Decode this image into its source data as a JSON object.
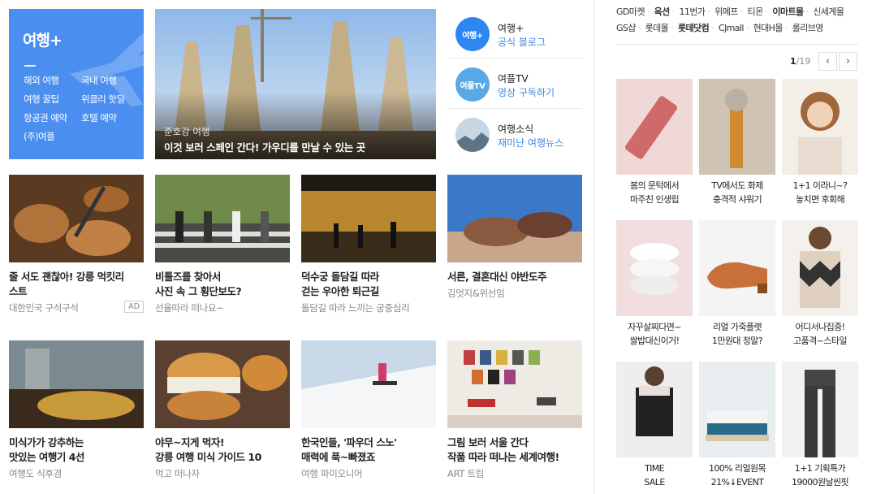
{
  "promo": {
    "title": "여행+",
    "links": [
      "해외 여행",
      "국내 여행",
      "여행 꿀팁",
      "위클리 핫딜",
      "항공권 예약",
      "호텔 예약",
      "(주)여플"
    ]
  },
  "hero": {
    "subtitle": "준호강 여행",
    "title": "이것 보러 스페인 간다! 가우디를 만날 수 있는 곳"
  },
  "channels": [
    {
      "logo": "여행+",
      "name": "여행+",
      "desc": "공식 블로그",
      "color": "#2f86f2"
    },
    {
      "logo": "여플TV",
      "name": "여플TV",
      "desc": "영상 구독하기",
      "color": "#5aa9e6"
    },
    {
      "logo": "",
      "name": "여행소식",
      "desc": "재미난 여행뉴스",
      "color": "#9fb6c8"
    }
  ],
  "cards": [
    {
      "line1": "줄 서도 괜찮아! 강릉 먹킷리",
      "line2": "스트",
      "source": "대한민국 구석구석",
      "badge": "AD"
    },
    {
      "line1": "비틀즈를 찾아서",
      "line2": "사진 속 그 횡단보도?",
      "source": "선율따라 떠나요~"
    },
    {
      "line1": "덕수궁 돌담길 따라",
      "line2": "걷는 우아한 퇴근길",
      "source": "돌담길 따라 느끼는 궁중심리"
    },
    {
      "line1": "서른, 결혼대신 야반도주",
      "line2": "",
      "source": "김멋지&위선임"
    },
    {
      "line1": "미식가가 강추하는",
      "line2": "맛있는 여행기 4선",
      "source": "여행도 식후경"
    },
    {
      "line1": "야무~지게 먹자!",
      "line2": "강릉 여행 미식 가이드 10",
      "source": "먹고 떠나자"
    },
    {
      "line1": "한국인들, '파우더 스노'",
      "line2": "매력에 푹~빠졌죠",
      "source": "여행 파이오니어"
    },
    {
      "line1": "그림 보러 서울 간다",
      "line2": "작품 따라 떠나는 세계여행!",
      "source": "ART 트립"
    }
  ],
  "shopping": {
    "row1": [
      {
        "label": "GD마켓",
        "bold": false
      },
      {
        "label": "옥션",
        "bold": true
      },
      {
        "label": "11번가",
        "bold": false
      },
      {
        "label": "위메프",
        "bold": false
      },
      {
        "label": "티몬",
        "bold": false
      },
      {
        "label": "이마트몰",
        "bold": true
      },
      {
        "label": "신세계몰",
        "bold": false
      }
    ],
    "row2": [
      {
        "label": "GS샵",
        "bold": false
      },
      {
        "label": "롯데몰",
        "bold": false
      },
      {
        "label": "롯데닷컴",
        "bold": true
      },
      {
        "label": "CJmall",
        "bold": false
      },
      {
        "label": "현대H몰",
        "bold": false
      },
      {
        "label": "롤리브영",
        "bold": false
      }
    ],
    "page_current": "1",
    "page_total": "/19",
    "prev_icon": "‹",
    "next_icon": "›",
    "products": [
      {
        "line1": "봄의 문턱에서",
        "line2": "마주친 인생립"
      },
      {
        "line1": "TV에서도 화제",
        "line2": "충격적 샤워기"
      },
      {
        "line1": "1+1 이라니~?",
        "line2": "놓치면 후회해"
      },
      {
        "line1": "자꾸살찌다면~",
        "line2": "쌀밥대신이거!"
      },
      {
        "line1": "리얼 가죽플랫",
        "line2": "1만원대 정말?"
      },
      {
        "line1": "어디서나집중!",
        "line2": "고품격~스타일"
      },
      {
        "line1": "TIME",
        "line2": "SALE"
      },
      {
        "line1": "100% 리얼원목",
        "line2": "21%↓EVENT"
      },
      {
        "line1": "1+1 기획특가",
        "line2": "19000원날씬핏"
      }
    ]
  }
}
